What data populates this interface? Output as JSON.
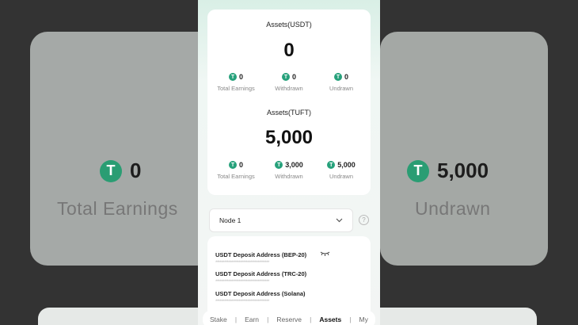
{
  "background": {
    "left_value": "0",
    "left_label": "Total Earnings",
    "right_value": "5,000",
    "right_label": "Undrawn"
  },
  "usdt": {
    "title": "Assets(USDT)",
    "value": "0",
    "stats": [
      {
        "value": "0",
        "label": "Total Earnings"
      },
      {
        "value": "0",
        "label": "Withdrawn"
      },
      {
        "value": "0",
        "label": "Undrawn"
      }
    ]
  },
  "tuft": {
    "title": "Assets(TUFT)",
    "value": "5,000",
    "stats": [
      {
        "value": "0",
        "label": "Total Earnings"
      },
      {
        "value": "3,000",
        "label": "Withdrawn"
      },
      {
        "value": "5,000",
        "label": "Undrawn"
      }
    ]
  },
  "node_select": {
    "value": "Node 1"
  },
  "deposits": [
    {
      "label": "USDT Deposit Address (BEP-20)",
      "masked": "*************************************"
    },
    {
      "label": "USDT Deposit Address (TRC-20)",
      "masked": "*************************************"
    },
    {
      "label": "USDT Deposit Address (Solana)",
      "masked": "*************************************"
    }
  ],
  "tabs": [
    "Stake",
    "Earn",
    "Reserve",
    "Assets",
    "My"
  ],
  "active_tab": "Assets",
  "coin_symbol": "T",
  "colors": {
    "coin": "#26a17b"
  }
}
